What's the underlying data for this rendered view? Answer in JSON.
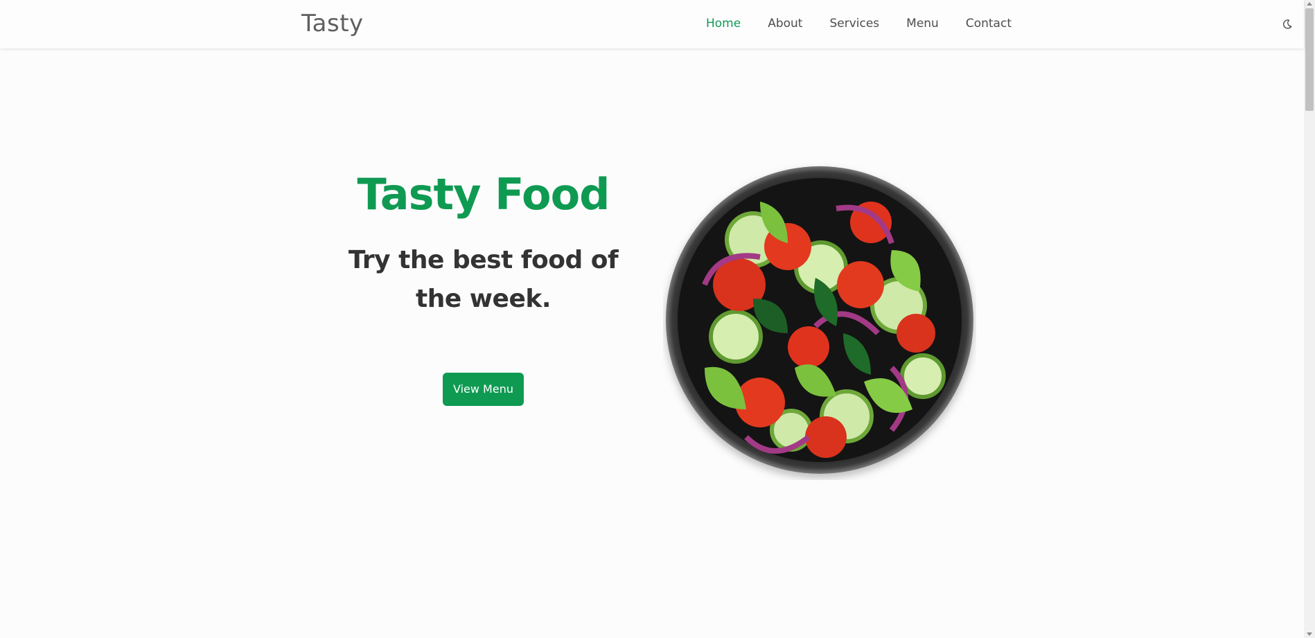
{
  "header": {
    "logo": "Tasty",
    "nav": [
      {
        "label": "Home",
        "active": true
      },
      {
        "label": "About",
        "active": false
      },
      {
        "label": "Services",
        "active": false
      },
      {
        "label": "Menu",
        "active": false
      },
      {
        "label": "Contact",
        "active": false
      }
    ],
    "theme_toggle_icon": "moon-icon"
  },
  "hero": {
    "title": "Tasty Food",
    "subtitle": "Try the best food of the week.",
    "cta_label": "View Menu",
    "image_icon": "salad-plate-icon"
  },
  "colors": {
    "accent": "#0f9a52",
    "text_dark": "#333333",
    "nav_text": "#4d4d4d",
    "logo_text": "#5f5f5f",
    "background": "#fcfcfd"
  }
}
